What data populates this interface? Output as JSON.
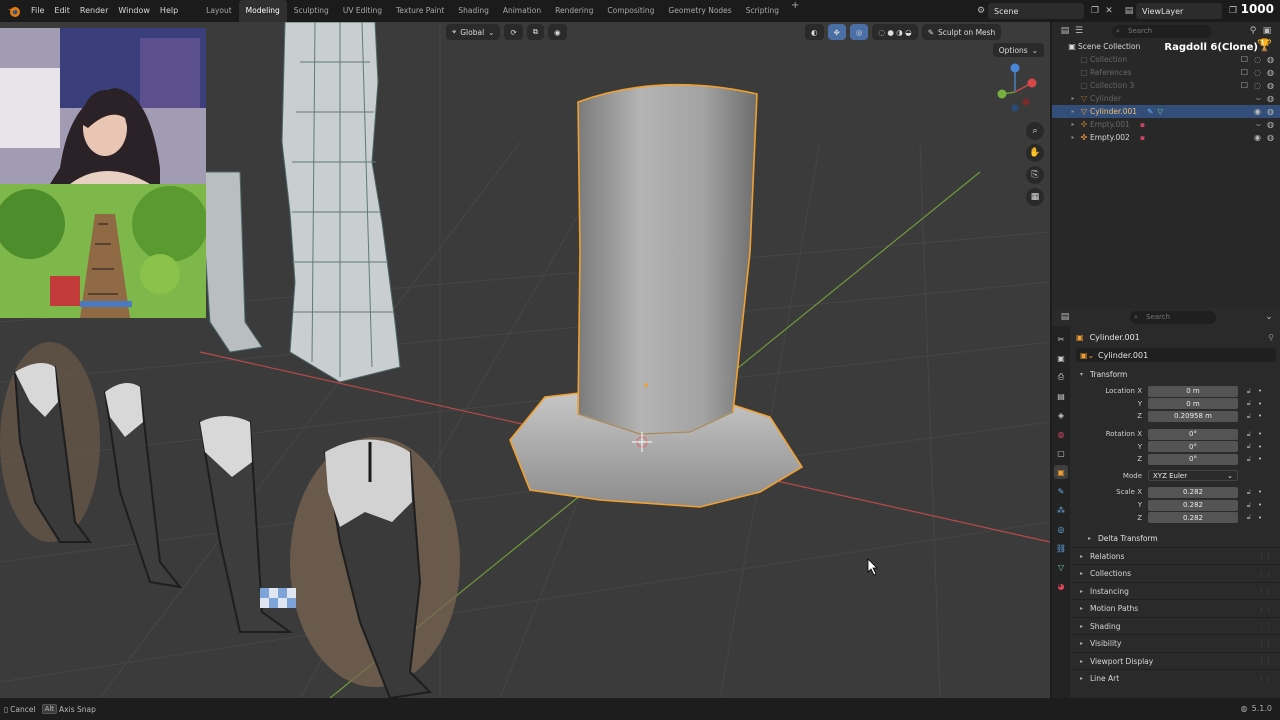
{
  "menu": {
    "items": [
      "File",
      "Edit",
      "Render",
      "Window",
      "Help"
    ],
    "workspace_tabs": [
      "Layout",
      "Modeling",
      "Sculpting",
      "UV Editing",
      "Texture Paint",
      "Shading",
      "Animation",
      "Rendering",
      "Compositing",
      "Geometry Nodes",
      "Scripting"
    ],
    "active_tab": "Modeling",
    "add": "+"
  },
  "scene": {
    "name": "Scene",
    "view_layer": "ViewLayer"
  },
  "counter": "1000",
  "viewport": {
    "orientation": "Global",
    "sculpt_label": "Sculpt on Mesh",
    "options_label": "Options"
  },
  "outliner": {
    "search_placeholder": "Search",
    "ragdoll_text": "Ragdoll 6(Clone)",
    "root": "Scene Collection",
    "rows": [
      {
        "label": "Collection",
        "state": "dim",
        "icon": "collection-icon"
      },
      {
        "label": "References",
        "state": "dim",
        "icon": "collection-icon"
      },
      {
        "label": "Collection 3",
        "state": "dim",
        "icon": "collection-icon"
      },
      {
        "label": "Cylinder",
        "state": "dim",
        "icon": "mesh-icon"
      },
      {
        "label": "Cylinder.001",
        "state": "selected",
        "icon": "mesh-icon"
      },
      {
        "label": "Empty.001",
        "state": "dim",
        "icon": "empty-icon"
      },
      {
        "label": "Empty.002",
        "state": "normal",
        "icon": "empty-icon"
      }
    ]
  },
  "properties": {
    "search_placeholder": "Search",
    "object_name": "Cylinder.001",
    "data_name": "Cylinder.001",
    "transform_title": "Transform",
    "location": {
      "label": "Location X",
      "x": "0 m",
      "y": "0 m",
      "z": "0.20958 m"
    },
    "rotation": {
      "label": "Rotation X",
      "x": "0°",
      "y": "0°",
      "z": "0°"
    },
    "mode": {
      "label": "Mode",
      "value": "XYZ Euler"
    },
    "scale": {
      "label": "Scale X",
      "x": "0.282",
      "y": "0.282",
      "z": "0.282"
    },
    "axis_y": "Y",
    "axis_z": "Z",
    "delta": "Delta Transform",
    "subpanels": [
      "Relations",
      "Collections",
      "Instancing",
      "Motion Paths",
      "Shading",
      "Visibility",
      "Viewport Display",
      "Line Art"
    ]
  },
  "status": {
    "cancel": "Cancel",
    "alt_key": "Alt",
    "axis_snap": "Axis Snap",
    "version": "5.1.0"
  },
  "colors": {
    "selection_outline": "#f0a030",
    "accent_blue": "#334e78",
    "viewport_bg": "#3b3b3b"
  }
}
